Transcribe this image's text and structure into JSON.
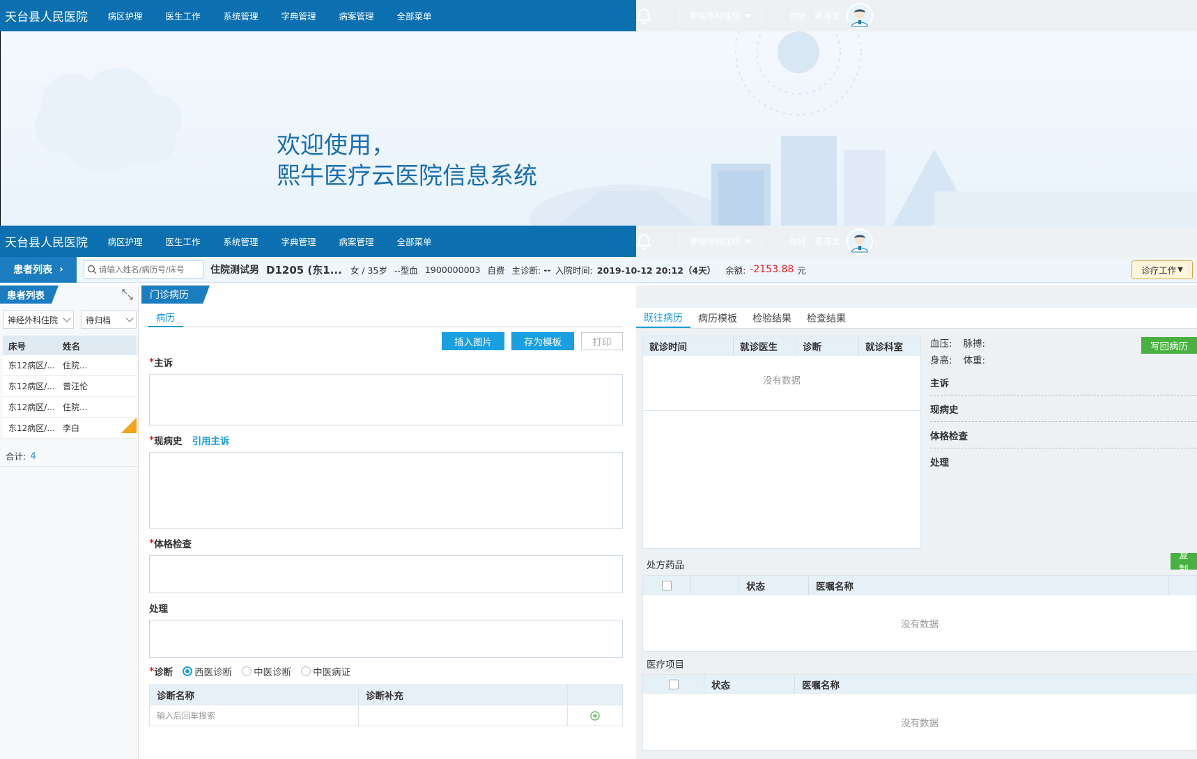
{
  "app": {
    "hospital_name": "天台县人民医院",
    "menu": [
      "病区护理",
      "医生工作",
      "系统管理",
      "字典管理",
      "病案管理",
      "全部菜单"
    ],
    "department": "神经外科住院",
    "greeting": "你好，蒋海龙"
  },
  "banner": {
    "line1": "欢迎使用，",
    "line2": "熙牛医疗云医院信息系统"
  },
  "patient_bar": {
    "list_tab": "患者列表",
    "search_placeholder": "请输入姓名/病历号/床号",
    "name": "住院测试男",
    "bed": "D1205 (东1...",
    "sex_age": "女 / 35岁",
    "blood": "--型血",
    "record_no": "1900000003",
    "pay_type": "自费",
    "main_diag_label": "主诊断:",
    "main_diag_value": "--",
    "admit_label": "入院时间:",
    "admit_value": "2019-10-12 20:12（4天）",
    "balance_label": "余额:",
    "balance_value": "-2153.88",
    "balance_unit": "元",
    "work_button": "诊疗工作"
  },
  "left_panel": {
    "title": "患者列表",
    "dept_filter": "神经外科住院",
    "status_filter": "待归档",
    "columns": [
      "床号",
      "姓名"
    ],
    "rows": [
      {
        "bed": "东12病区/...",
        "name": "住院..."
      },
      {
        "bed": "东12病区/...",
        "name": "曾汪伦"
      },
      {
        "bed": "东12病区/...",
        "name": "住院..."
      },
      {
        "bed": "东12病区/...",
        "name": "李白"
      }
    ],
    "total_label": "合计:",
    "total_value": "4"
  },
  "middle": {
    "title": "门诊病历",
    "tab": "病历",
    "buttons": {
      "insert_image": "插入图片",
      "save_template": "存为模板",
      "print": "打印"
    },
    "fields": {
      "complaint": "主诉",
      "present_history": "现病史",
      "quote_complaint": "引用主诉",
      "physical_exam": "体格检查",
      "treatment": "处理",
      "diagnosis": "诊断"
    },
    "diag_types": [
      "西医诊断",
      "中医诊断",
      "中医病证"
    ],
    "diag_columns": [
      "诊断名称",
      "诊断补充"
    ],
    "diag_input_placeholder": "输入后回车搜索"
  },
  "right": {
    "tabs": [
      "既往病历",
      "病历模板",
      "检验结果",
      "检查结果"
    ],
    "visit_columns": [
      "就诊时间",
      "就诊医生",
      "诊断",
      "就诊科室"
    ],
    "no_data": "没有数据",
    "vitals": {
      "bp": "血压:",
      "pulse": "脉搏:",
      "height": "身高:",
      "weight": "体重:"
    },
    "write_back": "写回病历",
    "sections": [
      "主诉",
      "现病史",
      "体格检查",
      "处理"
    ],
    "rx_title": "处方药品",
    "copy_button": "复制",
    "rx_columns": [
      "状态",
      "医嘱名称"
    ],
    "items_title": "医疗项目",
    "items_columns": [
      "状态",
      "医嘱名称"
    ]
  }
}
